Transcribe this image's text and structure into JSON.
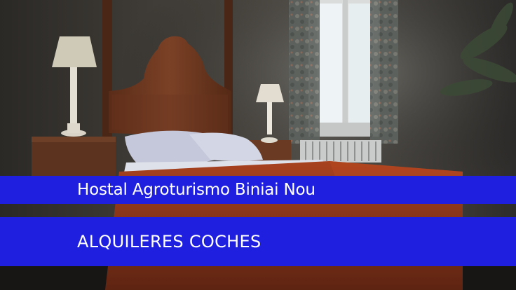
{
  "photo": {
    "subject": "hotel-bedroom",
    "palette": {
      "wall": "#3a3631",
      "headboard": "#6e3a22",
      "bedspread": "#9b3a1e",
      "pillow": "#c9ccdc",
      "window_light": "#e9f0f2",
      "curtain": "#6d6f6a"
    }
  },
  "banner": {
    "color": "#1f1fe0",
    "title": "Hostal Agroturismo Biniai Nou",
    "subtitle": "ALQUILERES COCHES"
  }
}
